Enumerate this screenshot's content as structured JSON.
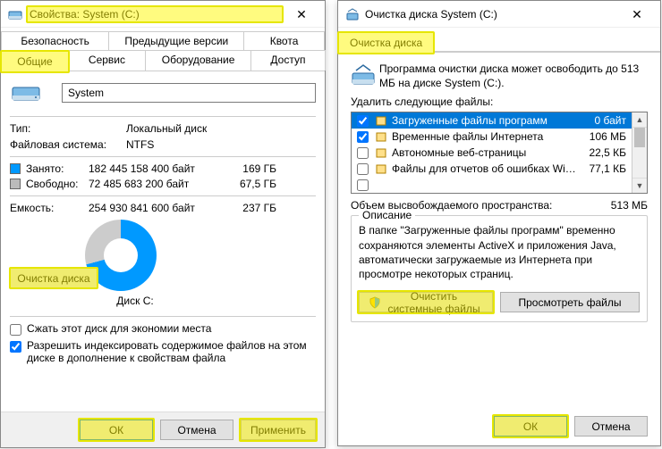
{
  "left": {
    "title": "Свойства: System (C:)",
    "tabs_row1": [
      "Безопасность",
      "Предыдущие версии",
      "Квота"
    ],
    "tabs_row2": [
      "Общие",
      "Сервис",
      "Оборудование",
      "Доступ"
    ],
    "active_tab": "Общие",
    "drive_name": "System",
    "type_label": "Тип:",
    "type_value": "Локальный диск",
    "fs_label": "Файловая система:",
    "fs_value": "NTFS",
    "used_label": "Занято:",
    "used_bytes": "182 445 158 400 байт",
    "used_gb": "169 ГБ",
    "free_label": "Свободно:",
    "free_bytes": "72 485 683 200 байт",
    "free_gb": "67,5 ГБ",
    "cap_label": "Емкость:",
    "cap_bytes": "254 930 841 600 байт",
    "cap_gb": "237 ГБ",
    "disk_caption": "Диск C:",
    "cleanup_btn": "Очистка диска",
    "compress_label": "Сжать этот диск для экономии места",
    "index_label": "Разрешить индексировать содержимое файлов на этом диске в дополнение к свойствам файла",
    "ok": "ОК",
    "cancel": "Отмена",
    "apply": "Применить"
  },
  "right": {
    "title": "Очистка диска System (C:)",
    "tab": "Очистка диска",
    "intro": "Программа очистки диска может освободить до 513 МБ на диске System (C:).",
    "delete_label": "Удалить следующие файлы:",
    "files": [
      {
        "checked": true,
        "name": "Загруженные файлы программ",
        "size": "0 байт",
        "selected": true
      },
      {
        "checked": true,
        "name": "Временные файлы Интернета",
        "size": "106 МБ"
      },
      {
        "checked": false,
        "name": "Автономные веб-страницы",
        "size": "22,5 КБ"
      },
      {
        "checked": false,
        "name": "Файлы для отчетов об ошибках Win...",
        "size": "77,1 КБ"
      }
    ],
    "total_label": "Объем высвобождаемого пространства:",
    "total_value": "513 МБ",
    "desc_title": "Описание",
    "desc_text": "В папке \"Загруженные файлы программ\" временно сохраняются элементы ActiveX и приложения Java, автоматически загружаемые из Интернета при просмотре некоторых страниц.",
    "clean_sys_btn": "Очистить системные файлы",
    "view_files_btn": "Просмотреть файлы",
    "ok": "ОК",
    "cancel": "Отмена"
  }
}
